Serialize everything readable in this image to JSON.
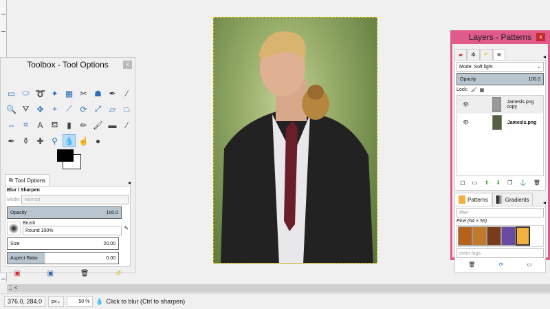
{
  "toolbox": {
    "title": "Toolbox - Tool Options",
    "close": "x",
    "tools": [
      "rect-select",
      "ellipse-select",
      "free-select",
      "fuzzy-select",
      "color-select",
      "scissors",
      "foreground-select",
      "paths",
      "color-picker",
      "zoom",
      "measure",
      "move",
      "align",
      "crop",
      "rotate",
      "scale",
      "shear",
      "perspective",
      "flip",
      "cage",
      "text",
      "bucket-fill",
      "blend",
      "pencil",
      "paintbrush",
      "eraser",
      "airbrush",
      "ink",
      "clone",
      "heal",
      "perspective-clone",
      "blur-sharpen",
      "smudge",
      "dodge-burn"
    ],
    "tab_label": "Tool Options",
    "tool_name": "Blur / Sharpen",
    "mode_label": "Mode:",
    "mode_value": "Normal",
    "opacity_label": "Opacity",
    "opacity_value": "100.0",
    "brush_label": "Brush",
    "brush_value": "Round 100%",
    "size_label": "Size",
    "size_value": "20.00",
    "aspect_label": "Aspect Ratio",
    "aspect_value": "0.00"
  },
  "layers": {
    "title": "Layers - Patterns",
    "close": "x",
    "mode": "Mode: Soft light",
    "opacity_label": "Opacity",
    "opacity_value": "100.0",
    "lock_label": "Lock:",
    "items": [
      {
        "name": "Jamesls.png copy"
      },
      {
        "name": "Jamesls.png"
      }
    ],
    "patterns_tab": "Patterns",
    "gradients_tab": "Gradients",
    "filter_placeholder": "filter",
    "pattern_name": "Pine (64 × 56)",
    "tags_placeholder": "enter tags",
    "pattern_colors": [
      "#b5621c",
      "#c07a2a",
      "#7a3a1c",
      "#6a4aa0",
      "#f2b040"
    ]
  },
  "status": {
    "coords": "376.0, 284.0",
    "unit": "px",
    "zoom": "50 %",
    "message": "Click to blur (Ctrl to sharpen)"
  },
  "colors": {
    "accent": "#e05a8a",
    "slider": "#b9c6cf",
    "selected_tool": "#bcdcf7"
  }
}
